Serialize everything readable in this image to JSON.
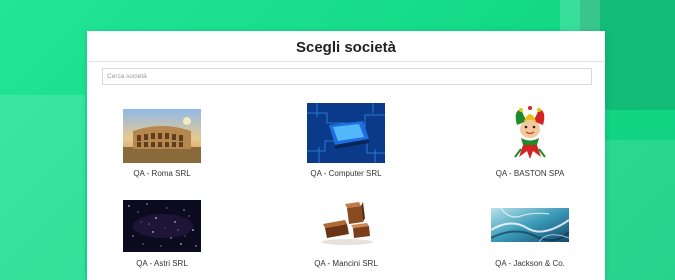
{
  "modal": {
    "title": "Scegli società",
    "search_placeholder": "Cerca società"
  },
  "companies": [
    {
      "name": "QA - Roma SRL",
      "image": "colosseum-photo"
    },
    {
      "name": "QA - Computer SRL",
      "image": "circuit-chip-photo"
    },
    {
      "name": "QA - BASTON SPA",
      "image": "jester-logo"
    },
    {
      "name": "QA - Astri SRL",
      "image": "starfield-photo"
    },
    {
      "name": "QA - Mancini SRL",
      "image": "chocolate-blocks-photo"
    },
    {
      "name": "QA - Jackson & Co.",
      "image": "marble-texture-photo"
    }
  ],
  "colors": {
    "background": "#1fe08f",
    "modal": "#ffffff"
  }
}
